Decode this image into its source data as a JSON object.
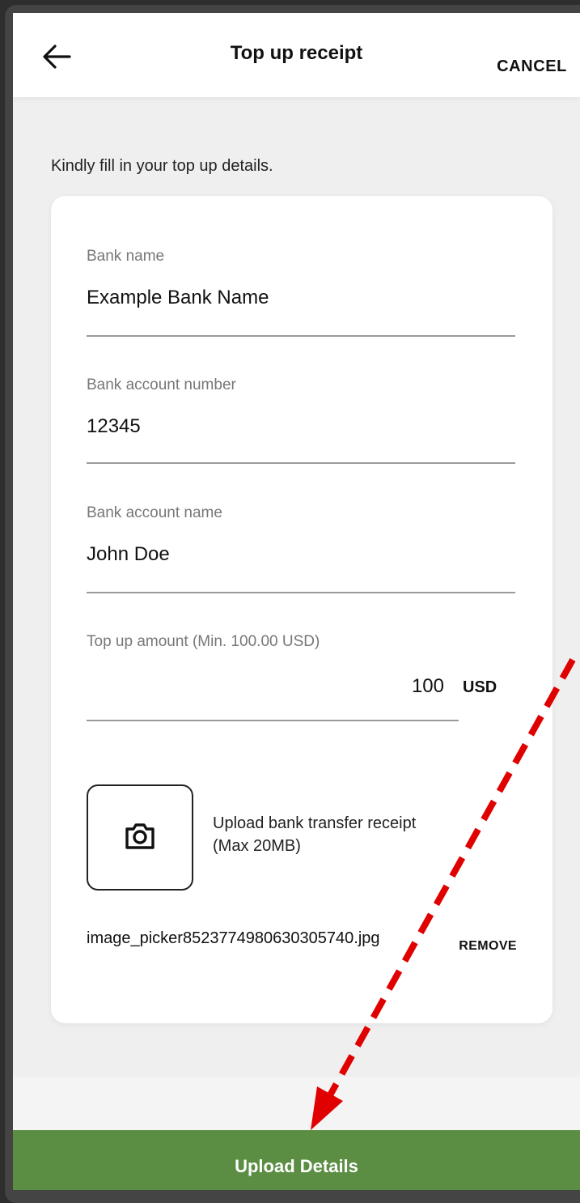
{
  "header": {
    "title": "Top up receipt",
    "cancel_label": "CANCEL"
  },
  "intro": "Kindly fill in your top up details.",
  "fields": {
    "bank_name": {
      "label": "Bank name",
      "value": "Example Bank Name"
    },
    "account_number": {
      "label": "Bank account number",
      "value": "12345"
    },
    "account_name": {
      "label": "Bank account name",
      "value": "John Doe"
    },
    "amount": {
      "label": "Top up amount (Min. 100.00 USD)",
      "value": "100",
      "unit": "USD"
    }
  },
  "upload": {
    "text_line1": "Upload bank transfer receipt",
    "text_line2": "(Max 20MB)",
    "file_name": "image_picker8523774980630305740.jpg",
    "remove_label": "REMOVE"
  },
  "primary_button": {
    "label": "Upload Details",
    "color": "#5b8d43"
  },
  "icons": {
    "back": "arrow-left-icon",
    "camera": "camera-icon"
  },
  "annotation": {
    "color": "#e00000"
  }
}
